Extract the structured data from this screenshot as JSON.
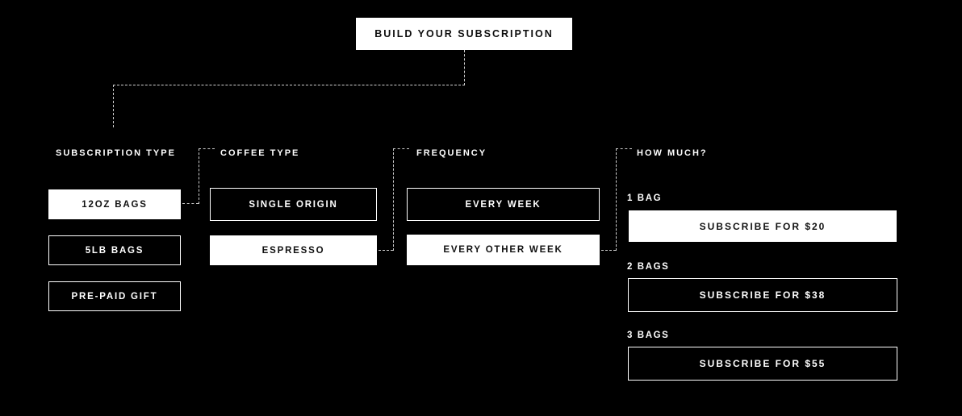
{
  "page": {
    "background_color": "#000000",
    "foreground_color": "#ffffff",
    "accent_color": "#ffffff"
  },
  "header": {
    "title": "BUILD YOUR SUBSCRIPTION"
  },
  "columns": [
    {
      "label": "SUBSCRIPTION TYPE",
      "options": [
        {
          "label": "12OZ BAGS",
          "selected": true
        },
        {
          "label": "5LB BAGS",
          "selected": false
        },
        {
          "label": "PRE-PAID GIFT",
          "selected": false
        }
      ]
    },
    {
      "label": "COFFEE TYPE",
      "options": [
        {
          "label": "SINGLE ORIGIN",
          "selected": false
        },
        {
          "label": "ESPRESSO",
          "selected": true
        }
      ]
    },
    {
      "label": "FREQUENCY",
      "options": [
        {
          "label": "EVERY WEEK",
          "selected": false
        },
        {
          "label": "EVERY OTHER WEEK",
          "selected": true
        }
      ]
    }
  ],
  "quantity": {
    "label": "HOW MUCH?",
    "tiers": [
      {
        "qty_label": "1 BAG",
        "button_label": "SUBSCRIBE FOR $20",
        "price": "$20",
        "hovered": true
      },
      {
        "qty_label": "2 BAGS",
        "button_label": "SUBSCRIBE FOR $38",
        "price": "$38",
        "hovered": false
      },
      {
        "qty_label": "3 BAGS",
        "button_label": "SUBSCRIBE FOR $55",
        "price": "$55",
        "hovered": false
      }
    ]
  },
  "connectors": {
    "style": "dashed",
    "color": "#cfcfcf",
    "description": "Dashed elbow lines link the title box to the first column and each selected option to the next column header."
  }
}
